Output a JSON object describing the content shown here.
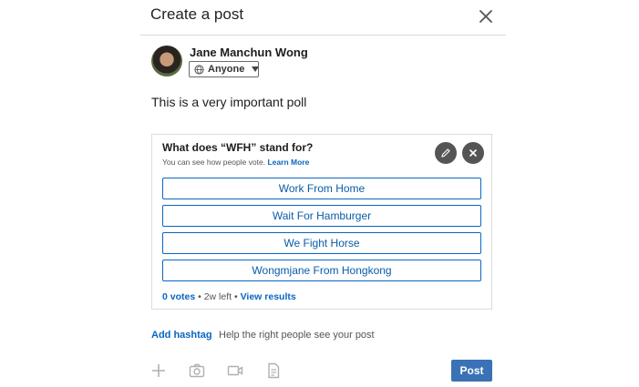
{
  "dialog": {
    "title": "Create a post"
  },
  "author": {
    "name": "Jane Manchun Wong",
    "visibility": "Anyone"
  },
  "post": {
    "text": "This is a very important poll"
  },
  "poll": {
    "question": "What does “WFH” stand for?",
    "subtitle": "You can see how people vote.",
    "learn_more": "Learn More",
    "options": [
      "Work From Home",
      "Wait For Hamburger",
      "We Fight Horse",
      "Wongmjane From Hongkong"
    ],
    "votes": "0 votes",
    "separator": "•",
    "time_left": "2w left",
    "view_results": "View results"
  },
  "hashtag": {
    "add_label": "Add hashtag",
    "hint": "Help the right people see your post"
  },
  "toolbar": {
    "icons": [
      "plus-icon",
      "camera-icon",
      "video-icon",
      "document-icon"
    ],
    "post_label": "Post"
  },
  "colors": {
    "accent": "#0a66c2",
    "post_button": "#3a72b5",
    "icon_gray": "#b0b0b0"
  }
}
